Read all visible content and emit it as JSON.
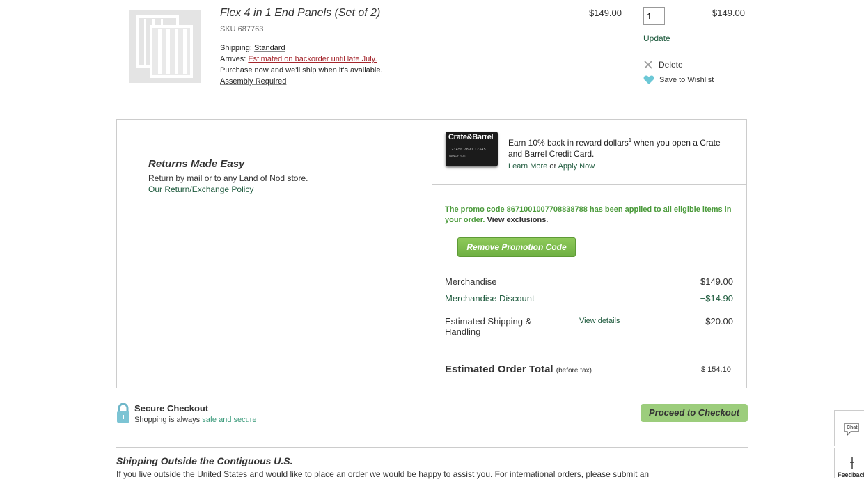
{
  "item": {
    "name": "Flex 4 in 1 End Panels (Set of 2)",
    "sku": "SKU 687763",
    "shipping_label": "Shipping:",
    "shipping_value": "Standard",
    "arrives_label": "Arrives:",
    "arrives_value": "Estimated on backorder until late July.",
    "purchase_note": "Purchase now and we'll ship when it's available.",
    "assembly": "Assembly Required",
    "unit_price": "$149.00",
    "quantity": "1",
    "line_total": "$149.00",
    "update_label": "Update",
    "delete_label": "Delete",
    "wishlist_label": "Save to Wishlist"
  },
  "returns": {
    "title": "Returns Made Easy",
    "text": "Return by mail or to any Land of Nod store.",
    "link": "Our Return/Exchange Policy"
  },
  "credit": {
    "card_brand": "Crate&Barrel",
    "card_number": "123456 7890 12345",
    "card_holder": "NANCY ROE",
    "earn_text_a": "Earn 10% back in reward dollars",
    "earn_sup": "1",
    "earn_text_b": " when you open a Crate and Barrel Credit Card.",
    "learn_more": "Learn More",
    "or": " or ",
    "apply_now": "Apply Now"
  },
  "promo": {
    "message": "The promo code 8671001007708838788 has been applied to all eligible items in your order.",
    "exclusions": " View exclusions.",
    "remove_button": "Remove Promotion Code"
  },
  "summary": {
    "merchandise_label": "Merchandise",
    "merchandise_value": "$149.00",
    "discount_label": "Merchandise Discount",
    "discount_value": "−$14.90",
    "shipping_label": "Estimated Shipping & Handling",
    "shipping_details": "View details",
    "shipping_value": "$20.00",
    "total_label": "Estimated Order Total",
    "total_note": "(before tax)",
    "total_value": "$ 154.10"
  },
  "checkout": {
    "secure_title": "Secure Checkout",
    "secure_sub_a": "Shopping is always ",
    "secure_sub_b": "safe and secure",
    "proceed": "Proceed to Checkout"
  },
  "outside": {
    "title": "Shipping Outside the Contiguous U.S.",
    "text": "If you live outside the United States and would like to place an order we would be happy to assist you. For international orders, please submit an"
  },
  "widgets": {
    "chat": "Chat",
    "feedback": "Feedback"
  },
  "colors": {
    "link_green": "#1f5b3e",
    "promo_green": "#4a9a3a",
    "backorder_red": "#a3252b",
    "button_green": "#9ccd7c"
  }
}
